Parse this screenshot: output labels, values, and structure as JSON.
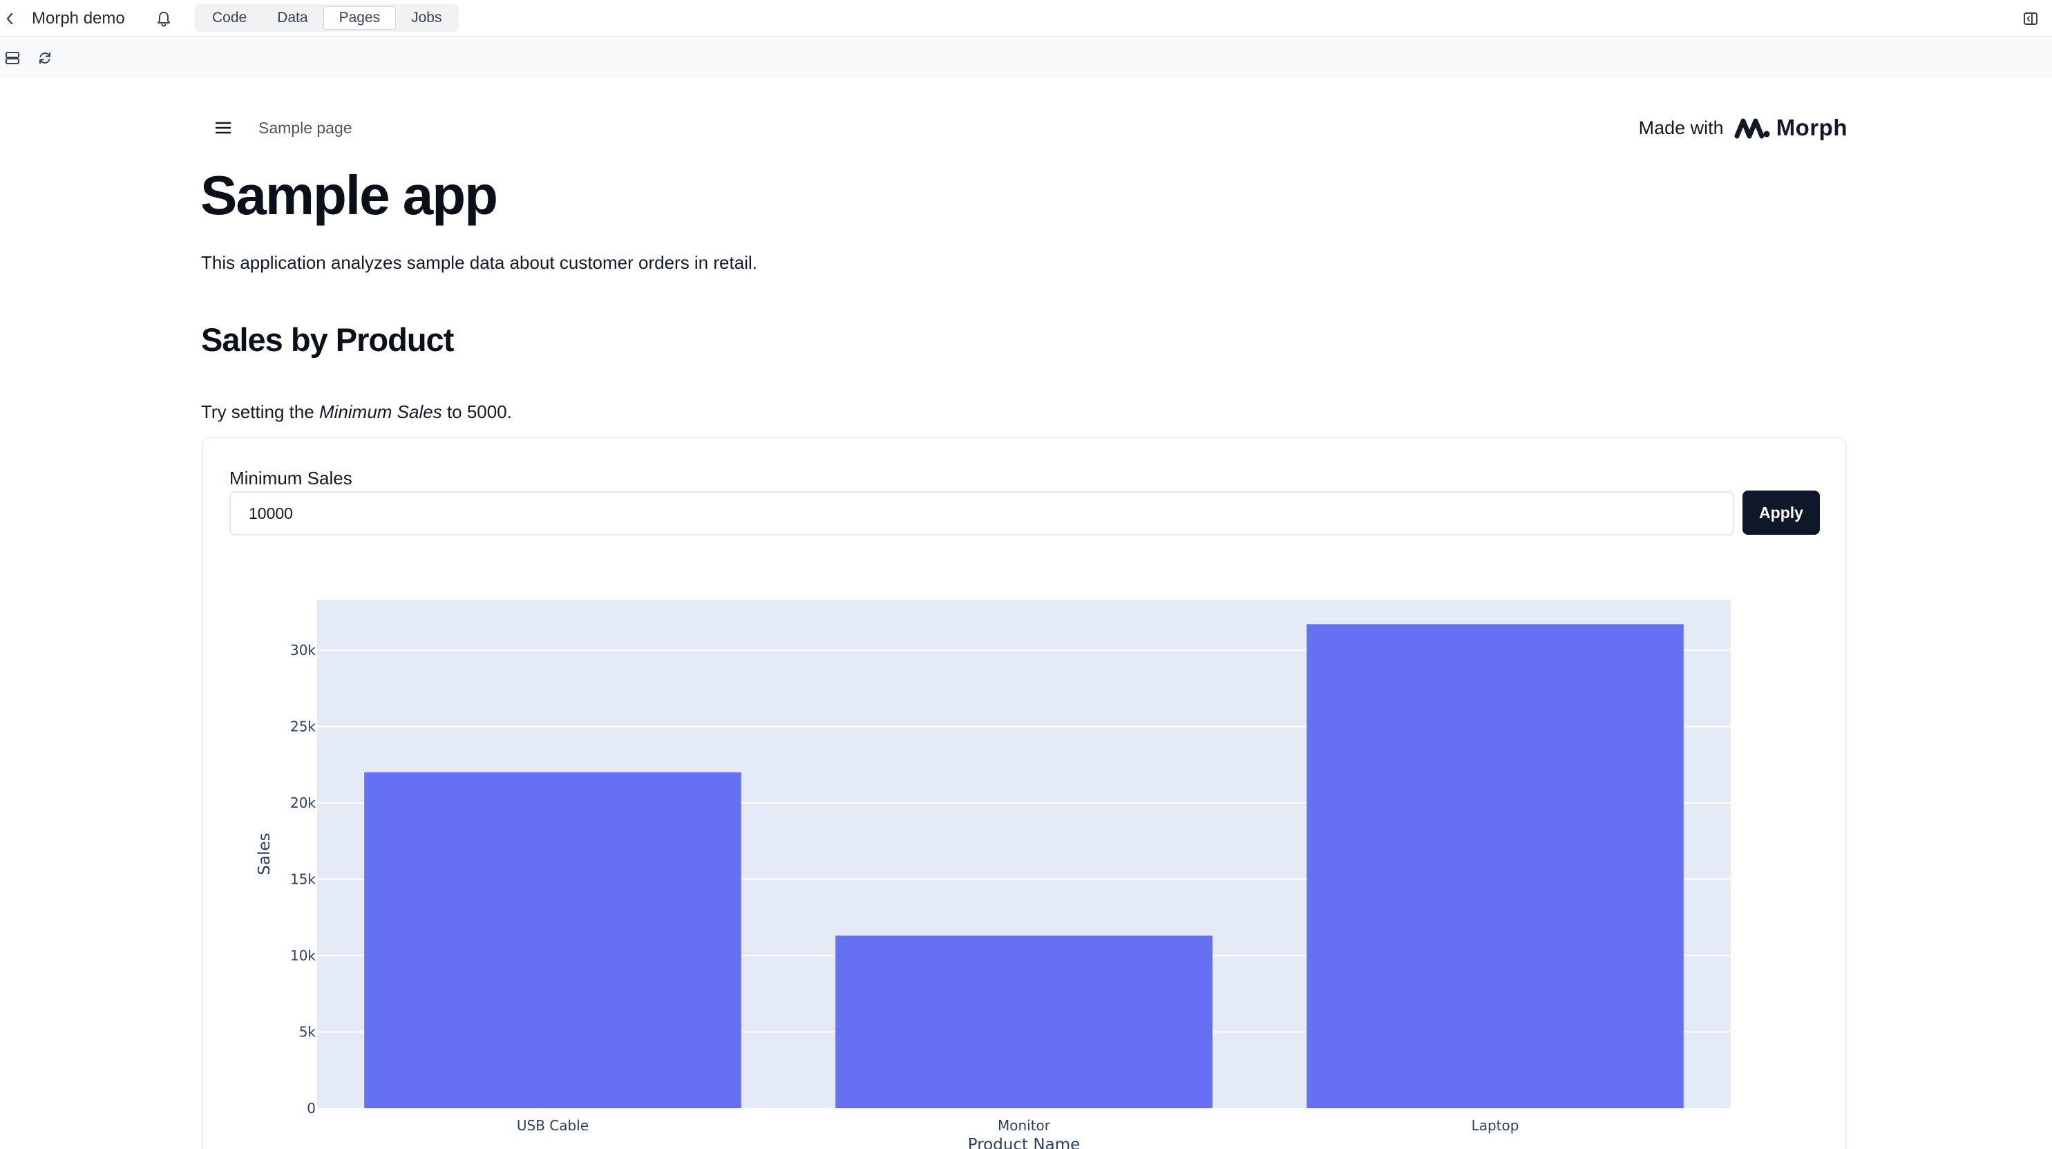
{
  "app": {
    "title": "Morph demo"
  },
  "tabs": [
    {
      "label": "Code",
      "active": false
    },
    {
      "label": "Data",
      "active": false
    },
    {
      "label": "Pages",
      "active": true
    },
    {
      "label": "Jobs",
      "active": false
    }
  ],
  "icons": {
    "back": "chevron-left-icon",
    "bell": "bell-icon",
    "panel": "panel-toggle-icon",
    "layout": "layout-icon",
    "refresh": "refresh-icon",
    "menu": "hamburger-menu-icon",
    "logo": "morph-logo-icon"
  },
  "page": {
    "breadcrumb": "Sample page",
    "made_with": "Made with",
    "brand": "Morph",
    "title": "Sample app",
    "intro": "This application analyzes sample data about customer orders in retail.",
    "section_title": "Sales by Product",
    "hint_prefix": "Try setting the ",
    "hint_emphasis": "Minimum Sales",
    "hint_suffix": " to 5000."
  },
  "form": {
    "label": "Minimum Sales",
    "value": "10000",
    "apply_label": "Apply"
  },
  "colors": {
    "bar": "#6670f2",
    "plot_bg": "#e5ebf6",
    "button_bg": "#0f172a",
    "tab_strip_bg": "#f1f2f4"
  },
  "chart_data": {
    "type": "bar",
    "categories": [
      "USB Cable",
      "Monitor",
      "Laptop"
    ],
    "values": [
      22000,
      11300,
      31700
    ],
    "ylabel": "Sales",
    "xlabel": "Product Name",
    "ylim": [
      0,
      33300
    ],
    "yticks": [
      0,
      5000,
      10000,
      15000,
      20000,
      25000,
      30000
    ],
    "ytick_labels": [
      "0",
      "5k",
      "10k",
      "15k",
      "20k",
      "25k",
      "30k"
    ],
    "grid": true
  }
}
